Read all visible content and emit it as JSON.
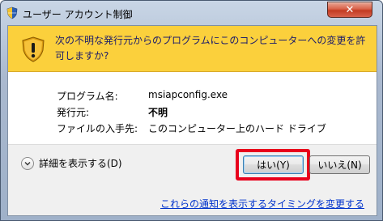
{
  "window": {
    "title": "ユーザー アカウント制御",
    "close_glyph": "✕",
    "title_icon": "uac-shield-icon"
  },
  "banner": {
    "icon": "warning-shield-icon",
    "message": "次の不明な発行元からのプログラムにこのコンピューターへの変更を許可しますか?",
    "color": "#fbd03c"
  },
  "details": [
    {
      "label": "プログラム名:",
      "value": "msiapconfig.exe"
    },
    {
      "label": "発行元:",
      "value": "不明"
    },
    {
      "label": "ファイルの入手先:",
      "value": "このコンピューター上のハード ドライブ"
    }
  ],
  "footer": {
    "show_details": "詳細を表示する(D)",
    "yes_button": "はい(Y)",
    "no_button": "いいえ(N)",
    "notify_link": "これらの通知を表示するタイミングを変更する",
    "highlight_color": "#e8001c"
  }
}
